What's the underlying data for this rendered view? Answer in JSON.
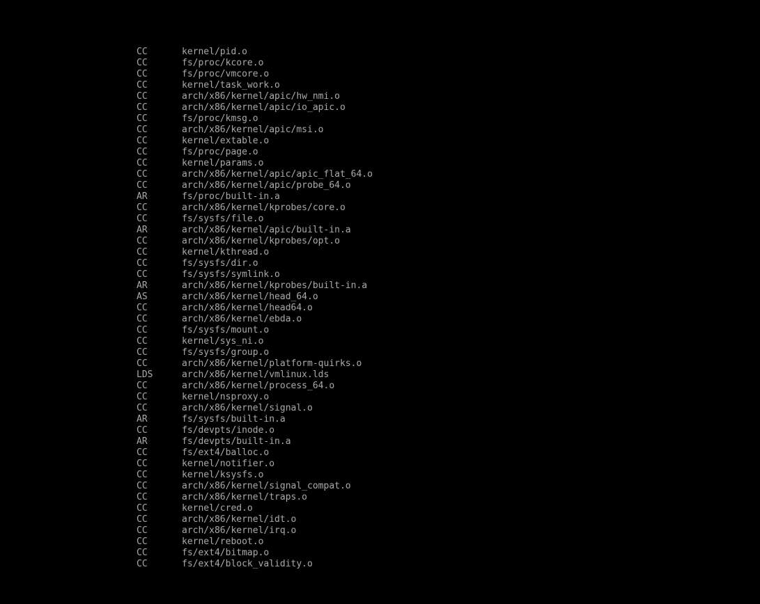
{
  "colors": {
    "background": "#000000",
    "text": "#aaaaaa"
  },
  "console": {
    "lines": [
      {
        "cmd": "CC",
        "path": "kernel/pid.o"
      },
      {
        "cmd": "CC",
        "path": "fs/proc/kcore.o"
      },
      {
        "cmd": "CC",
        "path": "fs/proc/vmcore.o"
      },
      {
        "cmd": "CC",
        "path": "kernel/task_work.o"
      },
      {
        "cmd": "CC",
        "path": "arch/x86/kernel/apic/hw_nmi.o"
      },
      {
        "cmd": "CC",
        "path": "arch/x86/kernel/apic/io_apic.o"
      },
      {
        "cmd": "CC",
        "path": "fs/proc/kmsg.o"
      },
      {
        "cmd": "CC",
        "path": "arch/x86/kernel/apic/msi.o"
      },
      {
        "cmd": "CC",
        "path": "kernel/extable.o"
      },
      {
        "cmd": "CC",
        "path": "fs/proc/page.o"
      },
      {
        "cmd": "CC",
        "path": "kernel/params.o"
      },
      {
        "cmd": "CC",
        "path": "arch/x86/kernel/apic/apic_flat_64.o"
      },
      {
        "cmd": "CC",
        "path": "arch/x86/kernel/apic/probe_64.o"
      },
      {
        "cmd": "AR",
        "path": "fs/proc/built-in.a"
      },
      {
        "cmd": "CC",
        "path": "arch/x86/kernel/kprobes/core.o"
      },
      {
        "cmd": "CC",
        "path": "fs/sysfs/file.o"
      },
      {
        "cmd": "AR",
        "path": "arch/x86/kernel/apic/built-in.a"
      },
      {
        "cmd": "CC",
        "path": "arch/x86/kernel/kprobes/opt.o"
      },
      {
        "cmd": "CC",
        "path": "kernel/kthread.o"
      },
      {
        "cmd": "CC",
        "path": "fs/sysfs/dir.o"
      },
      {
        "cmd": "CC",
        "path": "fs/sysfs/symlink.o"
      },
      {
        "cmd": "AR",
        "path": "arch/x86/kernel/kprobes/built-in.a"
      },
      {
        "cmd": "AS",
        "path": "arch/x86/kernel/head_64.o"
      },
      {
        "cmd": "CC",
        "path": "arch/x86/kernel/head64.o"
      },
      {
        "cmd": "CC",
        "path": "arch/x86/kernel/ebda.o"
      },
      {
        "cmd": "CC",
        "path": "fs/sysfs/mount.o"
      },
      {
        "cmd": "CC",
        "path": "kernel/sys_ni.o"
      },
      {
        "cmd": "CC",
        "path": "fs/sysfs/group.o"
      },
      {
        "cmd": "CC",
        "path": "arch/x86/kernel/platform-quirks.o"
      },
      {
        "cmd": "LDS",
        "path": "arch/x86/kernel/vmlinux.lds"
      },
      {
        "cmd": "CC",
        "path": "arch/x86/kernel/process_64.o"
      },
      {
        "cmd": "CC",
        "path": "kernel/nsproxy.o"
      },
      {
        "cmd": "CC",
        "path": "arch/x86/kernel/signal.o"
      },
      {
        "cmd": "AR",
        "path": "fs/sysfs/built-in.a"
      },
      {
        "cmd": "CC",
        "path": "fs/devpts/inode.o"
      },
      {
        "cmd": "AR",
        "path": "fs/devpts/built-in.a"
      },
      {
        "cmd": "CC",
        "path": "fs/ext4/balloc.o"
      },
      {
        "cmd": "CC",
        "path": "kernel/notifier.o"
      },
      {
        "cmd": "CC",
        "path": "kernel/ksysfs.o"
      },
      {
        "cmd": "CC",
        "path": "arch/x86/kernel/signal_compat.o"
      },
      {
        "cmd": "CC",
        "path": "arch/x86/kernel/traps.o"
      },
      {
        "cmd": "CC",
        "path": "kernel/cred.o"
      },
      {
        "cmd": "CC",
        "path": "arch/x86/kernel/idt.o"
      },
      {
        "cmd": "CC",
        "path": "arch/x86/kernel/irq.o"
      },
      {
        "cmd": "CC",
        "path": "kernel/reboot.o"
      },
      {
        "cmd": "CC",
        "path": "fs/ext4/bitmap.o"
      },
      {
        "cmd": "CC",
        "path": "fs/ext4/block_validity.o"
      }
    ]
  }
}
